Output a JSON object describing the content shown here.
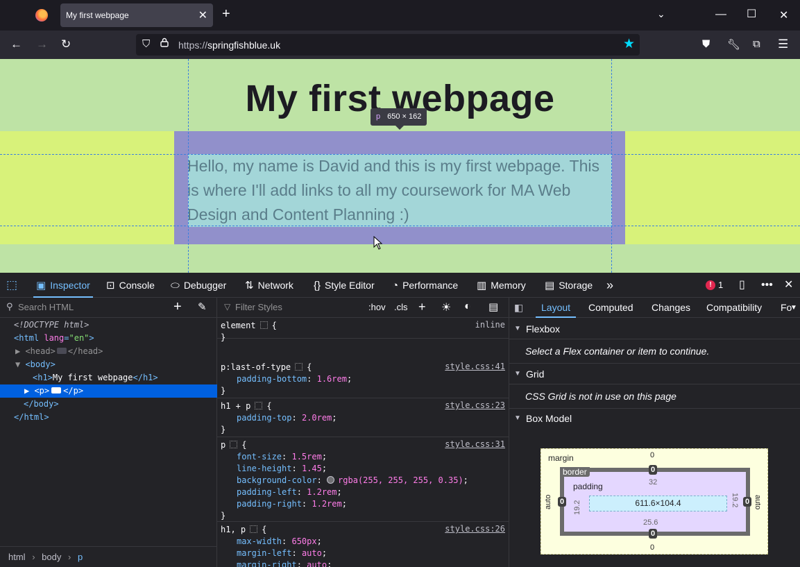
{
  "browser": {
    "tab_title": "My first webpage",
    "url_scheme": "https://",
    "url_host": "springfishblue.uk"
  },
  "page": {
    "heading": "My first webpage",
    "paragraph": "Hello, my name is David and this is my first webpage. This is where I'll add links to all my coursework for MA Web Design and Content Planning :)",
    "tooltip_tag": "p",
    "tooltip_size": "650 × 162"
  },
  "devtools": {
    "tabs": [
      "Inspector",
      "Console",
      "Debugger",
      "Network",
      "Style Editor",
      "Performance",
      "Memory",
      "Storage"
    ],
    "error_count": "1",
    "search_html_placeholder": "Search HTML",
    "filter_styles_placeholder": "Filter Styles",
    "hov_label": ":hov",
    "cls_label": ".cls",
    "markup": {
      "doctype": "<!DOCTYPE html>",
      "html_open_tag": "<html ",
      "html_attr": "lang",
      "html_eq": "=",
      "html_attr_val": "\"en\"",
      "html_close_gt": ">",
      "head_open": "<head>",
      "head_close": "</head>",
      "body_open": "<body>",
      "h1_open": "<h1>",
      "h1_text": "My first webpage",
      "h1_close": "</h1>",
      "p_open": "<p>",
      "p_close": "</p>",
      "body_close": "</body>",
      "html_close": "</html>"
    },
    "breadcrumbs": [
      "html",
      "body",
      "p"
    ],
    "rules": [
      {
        "selector": "element",
        "source": "inline",
        "decls": []
      },
      {
        "selector": "p:last-of-type",
        "source": "style.css:41",
        "decls": [
          {
            "p": "padding-bottom",
            "v": "1.6rem"
          }
        ]
      },
      {
        "selector": "h1 + p",
        "source": "style.css:23",
        "decls": [
          {
            "p": "padding-top",
            "v": "2.0rem"
          }
        ]
      },
      {
        "selector": "p",
        "source": "style.css:31",
        "decls": [
          {
            "p": "font-size",
            "v": "1.5rem"
          },
          {
            "p": "line-height",
            "v": "1.45"
          },
          {
            "p": "background-color",
            "v": "rgba(255, 255, 255, 0.35)"
          },
          {
            "p": "padding-left",
            "v": "1.2rem"
          },
          {
            "p": "padding-right",
            "v": "1.2rem"
          }
        ]
      },
      {
        "selector": "h1, p",
        "source": "style.css:26",
        "decls": [
          {
            "p": "max-width",
            "v": "650px"
          },
          {
            "p": "margin-left",
            "v": "auto"
          },
          {
            "p": "margin-right",
            "v": "auto"
          }
        ]
      }
    ],
    "side_tabs": [
      "Layout",
      "Computed",
      "Changes",
      "Compatibility",
      "Fo"
    ],
    "sections": {
      "flexbox_title": "Flexbox",
      "flexbox_msg": "Select a Flex container or item to continue.",
      "grid_title": "Grid",
      "grid_msg": "CSS Grid is not in use on this page",
      "boxmodel_title": "Box Model"
    },
    "box_model": {
      "margin_label": "margin",
      "border_label": "border",
      "padding_label": "padding",
      "margin_top": "0",
      "margin_bottom": "0",
      "margin_left": "auto",
      "margin_right": "auto",
      "border_top": "0",
      "border_bottom": "0",
      "border_left": "0",
      "border_right": "0",
      "padding_top": "32",
      "padding_bottom": "25.6",
      "padding_left": "19.2",
      "padding_right": "19.2",
      "content": "611.6×104.4"
    }
  },
  "colors": {
    "page_green": "#bee3a5",
    "p_band": "#d8f27a",
    "highlight_padding": "#9190cb",
    "highlight_content": "#a3d6d8",
    "accent": "#75bfff"
  }
}
